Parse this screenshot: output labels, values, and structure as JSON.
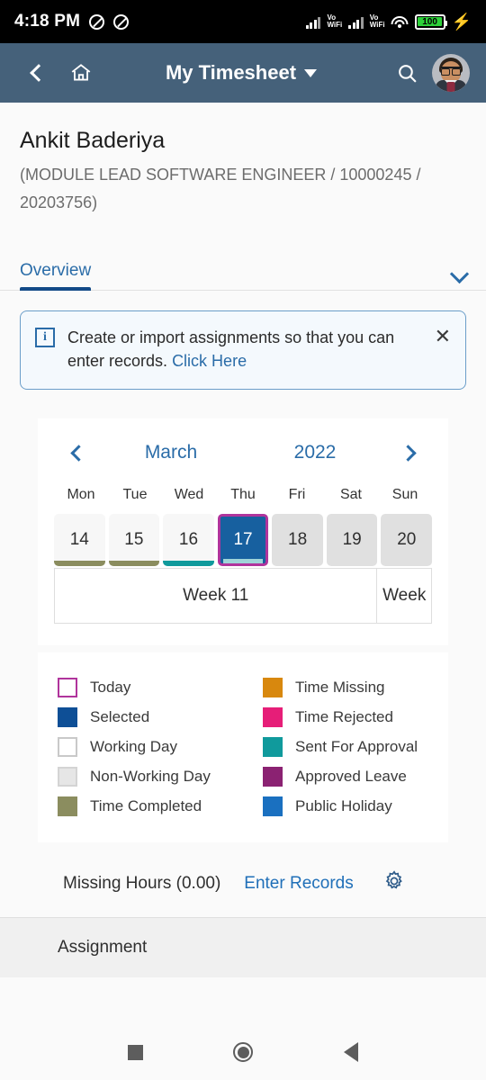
{
  "status_bar": {
    "time": "4:18 PM",
    "icons": [
      "no-sound-icon",
      "no-sound-icon",
      "signal-bars-icon",
      "vowifi-label",
      "signal-bars-icon",
      "vowifi-label",
      "wifi-icon",
      "battery-icon",
      "charging-bolt-icon"
    ],
    "vowifi_line1": "Vo",
    "vowifi_line2": "WiFi",
    "battery_level": "100"
  },
  "appbar": {
    "back_icon": "chevron-left-icon",
    "home_icon": "home-icon",
    "title": "My Timesheet",
    "title_caret": "caret-down-icon",
    "search_icon": "search-icon",
    "avatar": "user-avatar",
    "bg_color": "#45617a"
  },
  "person": {
    "name": "Ankit Baderiya",
    "meta": "(MODULE LEAD SOFTWARE ENGINEER / 10000245 / 20203756)"
  },
  "tabs": {
    "items": [
      {
        "label": "Overview",
        "active": true
      }
    ],
    "expand_icon": "chevron-down-icon"
  },
  "message": {
    "icon": "info-icon",
    "text": "Create or import assignments so that you can enter records. ",
    "link": "Click Here",
    "close_icon": "close-icon"
  },
  "calendar": {
    "prev_icon": "chevron-left-icon",
    "next_icon": "chevron-right-icon",
    "month": "March",
    "year": "2022",
    "weekdays": [
      "Mon",
      "Tue",
      "Wed",
      "Thu",
      "Fri",
      "Sat",
      "Sun"
    ],
    "days": [
      {
        "num": "14",
        "state": "working",
        "bar": "#8b8d5f"
      },
      {
        "num": "15",
        "state": "working",
        "bar": "#8b8d5f"
      },
      {
        "num": "16",
        "state": "working",
        "bar": "#109a9c"
      },
      {
        "num": "17",
        "state": "selected",
        "bar": "#9fd4d8"
      },
      {
        "num": "18",
        "state": "nonwork",
        "bar": ""
      },
      {
        "num": "19",
        "state": "nonwork",
        "bar": ""
      },
      {
        "num": "20",
        "state": "nonwork",
        "bar": ""
      }
    ],
    "week_main": "Week 11",
    "week_part": "Week"
  },
  "legend": {
    "left": [
      {
        "label": "Today",
        "color": "#ffffff",
        "border": "#b0349c"
      },
      {
        "label": "Selected",
        "color": "#0e4f96",
        "border": "#0e4f96"
      },
      {
        "label": "Working Day",
        "color": "#ffffff",
        "border": "#c9c9c9"
      },
      {
        "label": "Non-Working Day",
        "color": "#e6e6e6",
        "border": "#d4d4d4"
      },
      {
        "label": "Time Completed",
        "color": "#8b8d5f",
        "border": "#8b8d5f"
      }
    ],
    "right": [
      {
        "label": "Time Missing",
        "color": "#d8880e",
        "border": "#d8880e"
      },
      {
        "label": "Time Rejected",
        "color": "#e61e78",
        "border": "#e61e78"
      },
      {
        "label": "Sent For Approval",
        "color": "#109a9c",
        "border": "#109a9c"
      },
      {
        "label": "Approved Leave",
        "color": "#8b2272",
        "border": "#8b2272"
      },
      {
        "label": "Public Holiday",
        "color": "#1a70c0",
        "border": "#1a70c0"
      }
    ]
  },
  "footer": {
    "missing_hours": "Missing Hours (0.00)",
    "enter_records": "Enter Records",
    "gear_icon": "gear-icon",
    "assignment_header": "Assignment"
  },
  "navbar": {
    "recents_icon": "square-recents-icon",
    "home_icon": "circle-home-icon",
    "back_icon": "triangle-back-icon"
  }
}
